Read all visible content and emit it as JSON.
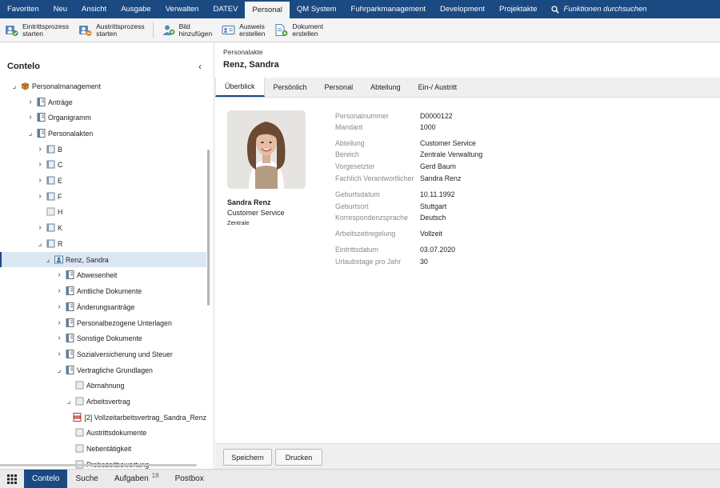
{
  "menu": {
    "items": [
      "Favoriten",
      "Neu",
      "Ansicht",
      "Ausgabe",
      "Verwalten",
      "DATEV",
      "Personal",
      "QM System",
      "Fuhrparkmanagement",
      "Development",
      "Projektakte"
    ],
    "active": "Personal",
    "search_placeholder": "Funktionen durchsuchen"
  },
  "ribbon": {
    "buttons": [
      {
        "label": "Eintrittsprozess\nstarten",
        "icon": "entry-process-icon"
      },
      {
        "label": "Austrittsprozess\nstarten",
        "icon": "exit-process-icon"
      },
      {
        "label": "Bild\nhinzufügen",
        "icon": "add-image-icon"
      },
      {
        "label": "Ausweis\nerstellen",
        "icon": "id-card-icon"
      },
      {
        "label": "Dokument\nerstellen",
        "icon": "create-document-icon"
      }
    ]
  },
  "sidebar": {
    "title": "Contelo",
    "tree": [
      {
        "label": "Personalmanagement",
        "toggle": "⌟",
        "icon": "box"
      },
      {
        "label": "Anträge",
        "toggle": "›",
        "icon": "binder"
      },
      {
        "label": "Organigramm",
        "toggle": "›",
        "icon": "binder"
      },
      {
        "label": "Personalakten",
        "toggle": "⌟",
        "icon": "binder"
      },
      {
        "label": "B",
        "toggle": "›",
        "icon": "folder"
      },
      {
        "label": "C",
        "toggle": "›",
        "icon": "folder"
      },
      {
        "label": "E",
        "toggle": "›",
        "icon": "folder"
      },
      {
        "label": "F",
        "toggle": "›",
        "icon": "folder"
      },
      {
        "label": "H",
        "toggle": "",
        "icon": "folder-empty"
      },
      {
        "label": "K",
        "toggle": "›",
        "icon": "folder"
      },
      {
        "label": "R",
        "toggle": "⌟",
        "icon": "folder"
      },
      {
        "label": "Renz, Sandra",
        "toggle": "⌟",
        "icon": "person-file",
        "selected": true
      },
      {
        "label": "Abwesenheit",
        "toggle": "›",
        "icon": "binder"
      },
      {
        "label": "Amtliche Dokumente",
        "toggle": "›",
        "icon": "binder"
      },
      {
        "label": "Änderungsanträge",
        "toggle": "›",
        "icon": "binder"
      },
      {
        "label": "Personalbezogene Unterlagen",
        "toggle": "›",
        "icon": "binder"
      },
      {
        "label": "Sonstige Dokumente",
        "toggle": "›",
        "icon": "binder"
      },
      {
        "label": "Sozialversicherung und Steuer",
        "toggle": "›",
        "icon": "binder"
      },
      {
        "label": "Vertragliche Grundlagen",
        "toggle": "⌟",
        "icon": "binder"
      },
      {
        "label": "Abmahnung",
        "toggle": "",
        "icon": "folder-empty"
      },
      {
        "label": "Arbeitsvertrag",
        "toggle": "⌟",
        "icon": "folder-empty"
      },
      {
        "label": "[2] Vollzeitarbeitsvertrag_Sandra_Renz",
        "toggle": "",
        "icon": "pdf"
      },
      {
        "label": "Austrittsdokumente",
        "toggle": "",
        "icon": "folder-empty"
      },
      {
        "label": "Nebentätigkeit",
        "toggle": "",
        "icon": "folder-empty"
      },
      {
        "label": "Probezeitbewertung",
        "toggle": "",
        "icon": "folder-empty"
      }
    ]
  },
  "record": {
    "subtitle": "Personalakte",
    "title": "Renz, Sandra",
    "tabs": [
      "Überblick",
      "Persönlich",
      "Personal",
      "Abteilung",
      "Ein-/ Austritt"
    ],
    "active_tab": "Überblick",
    "person": {
      "name": "Sandra Renz",
      "department": "Customer Service",
      "location": "Zentrale"
    },
    "fields": [
      {
        "label": "Personalnummer",
        "value": "D0000122"
      },
      {
        "label": "Mandant",
        "value": "1000"
      },
      {
        "label": "Abteilung",
        "value": "Customer Service"
      },
      {
        "label": "Bereich",
        "value": "Zentrale Verwaltung"
      },
      {
        "label": "Vorgesetzter",
        "value": "Gerd Baum"
      },
      {
        "label": "Fachlich Verantwortlicher",
        "value": "Sandra Renz"
      },
      {
        "label": "Geburtsdatum",
        "value": "10.11.1992"
      },
      {
        "label": "Geburtsort",
        "value": "Stuttgart"
      },
      {
        "label": "Korrespondenzsprache",
        "value": "Deutsch"
      },
      {
        "label": "Arbeitszeitregelung",
        "value": "Vollzeit"
      },
      {
        "label": "Eintrittsdatum",
        "value": "03.07.2020"
      },
      {
        "label": "Urlaubstage pro Jahr",
        "value": "30"
      }
    ],
    "buttons": {
      "save": "Speichern",
      "print": "Drucken"
    }
  },
  "taskbar": {
    "items": [
      {
        "label": "Contelo",
        "active": true
      },
      {
        "label": "Suche"
      },
      {
        "label": "Aufgaben",
        "badge": "18"
      },
      {
        "label": "Postbox"
      }
    ]
  },
  "colors": {
    "primary": "#1b4a82",
    "selection": "#dbe7f3",
    "label_gray": "#8a8a8a"
  }
}
